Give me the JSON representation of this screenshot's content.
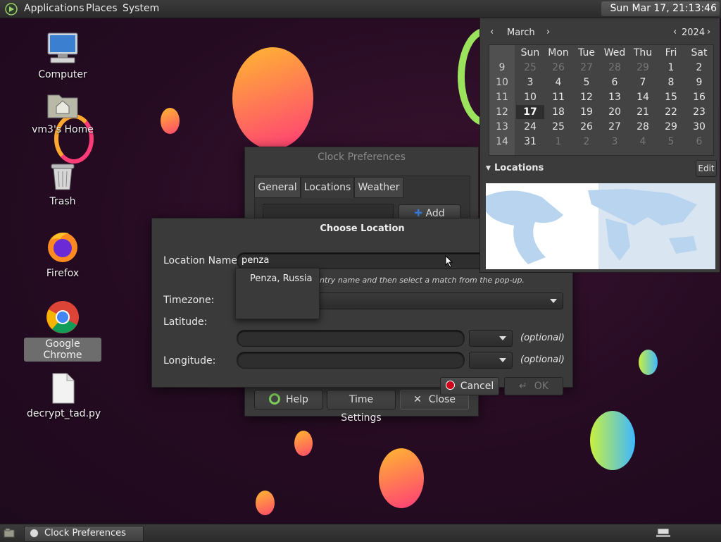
{
  "top_panel": {
    "menus": [
      "Applications",
      "Places",
      "System"
    ],
    "clock": "Sun Mar 17, 21:13:46"
  },
  "desktop_icons": [
    {
      "label": "Computer",
      "icon": "computer-icon"
    },
    {
      "label": "vm3's Home",
      "icon": "home-folder-icon"
    },
    {
      "label": "Trash",
      "icon": "trash-icon"
    },
    {
      "label": "Firefox",
      "icon": "firefox-icon"
    },
    {
      "label": "Google Chrome",
      "icon": "chrome-icon",
      "selected": true
    },
    {
      "label": "decrypt_tad.py",
      "icon": "file-icon"
    }
  ],
  "calendar": {
    "month": "March",
    "year": "2024",
    "weekdays": [
      "Sun",
      "Mon",
      "Tue",
      "Wed",
      "Thu",
      "Fri",
      "Sat"
    ],
    "weeks": [
      {
        "num": "9",
        "days": [
          "25",
          "26",
          "27",
          "28",
          "29",
          "1",
          "2"
        ]
      },
      {
        "num": "10",
        "days": [
          "3",
          "4",
          "5",
          "6",
          "7",
          "8",
          "9"
        ]
      },
      {
        "num": "11",
        "days": [
          "10",
          "11",
          "12",
          "13",
          "14",
          "15",
          "16"
        ]
      },
      {
        "num": "12",
        "days": [
          "17",
          "18",
          "19",
          "20",
          "21",
          "22",
          "23"
        ]
      },
      {
        "num": "13",
        "days": [
          "24",
          "25",
          "26",
          "27",
          "28",
          "29",
          "30"
        ]
      },
      {
        "num": "14",
        "days": [
          "31",
          "1",
          "2",
          "3",
          "4",
          "5",
          "6"
        ]
      }
    ],
    "today": "17",
    "locations_label": "Locations",
    "edit_label": "Edit"
  },
  "clock_prefs": {
    "title": "Clock Preferences",
    "tabs": [
      "General",
      "Locations",
      "Weather"
    ],
    "active_tab": "Locations",
    "add_label": "Add",
    "help_label": "Help",
    "time_settings_label": "Time Settings",
    "close_label": "Close"
  },
  "choose_location": {
    "title": "Choose Location",
    "location_name_label": "Location Name:",
    "location_name_value": "penza",
    "hint": "Type a city, region, or country name and then select a match from the pop-up.",
    "hint_visible": "ntry name and then select a match from the pop-up.",
    "timezone_label": "Timezone:",
    "latitude_label": "Latitude:",
    "longitude_label": "Longitude:",
    "optional_label": "(optional)",
    "cancel_label": "Cancel",
    "ok_label": "OK",
    "suggestion": "Penza, Russia"
  },
  "taskbar": {
    "task_label": "Clock Preferences"
  },
  "colors": {
    "accent_blue": "#3a7bd5",
    "cancel_red": "#d0021b",
    "map_ocean": "#ffffff",
    "map_land": "#b8d4ef"
  }
}
